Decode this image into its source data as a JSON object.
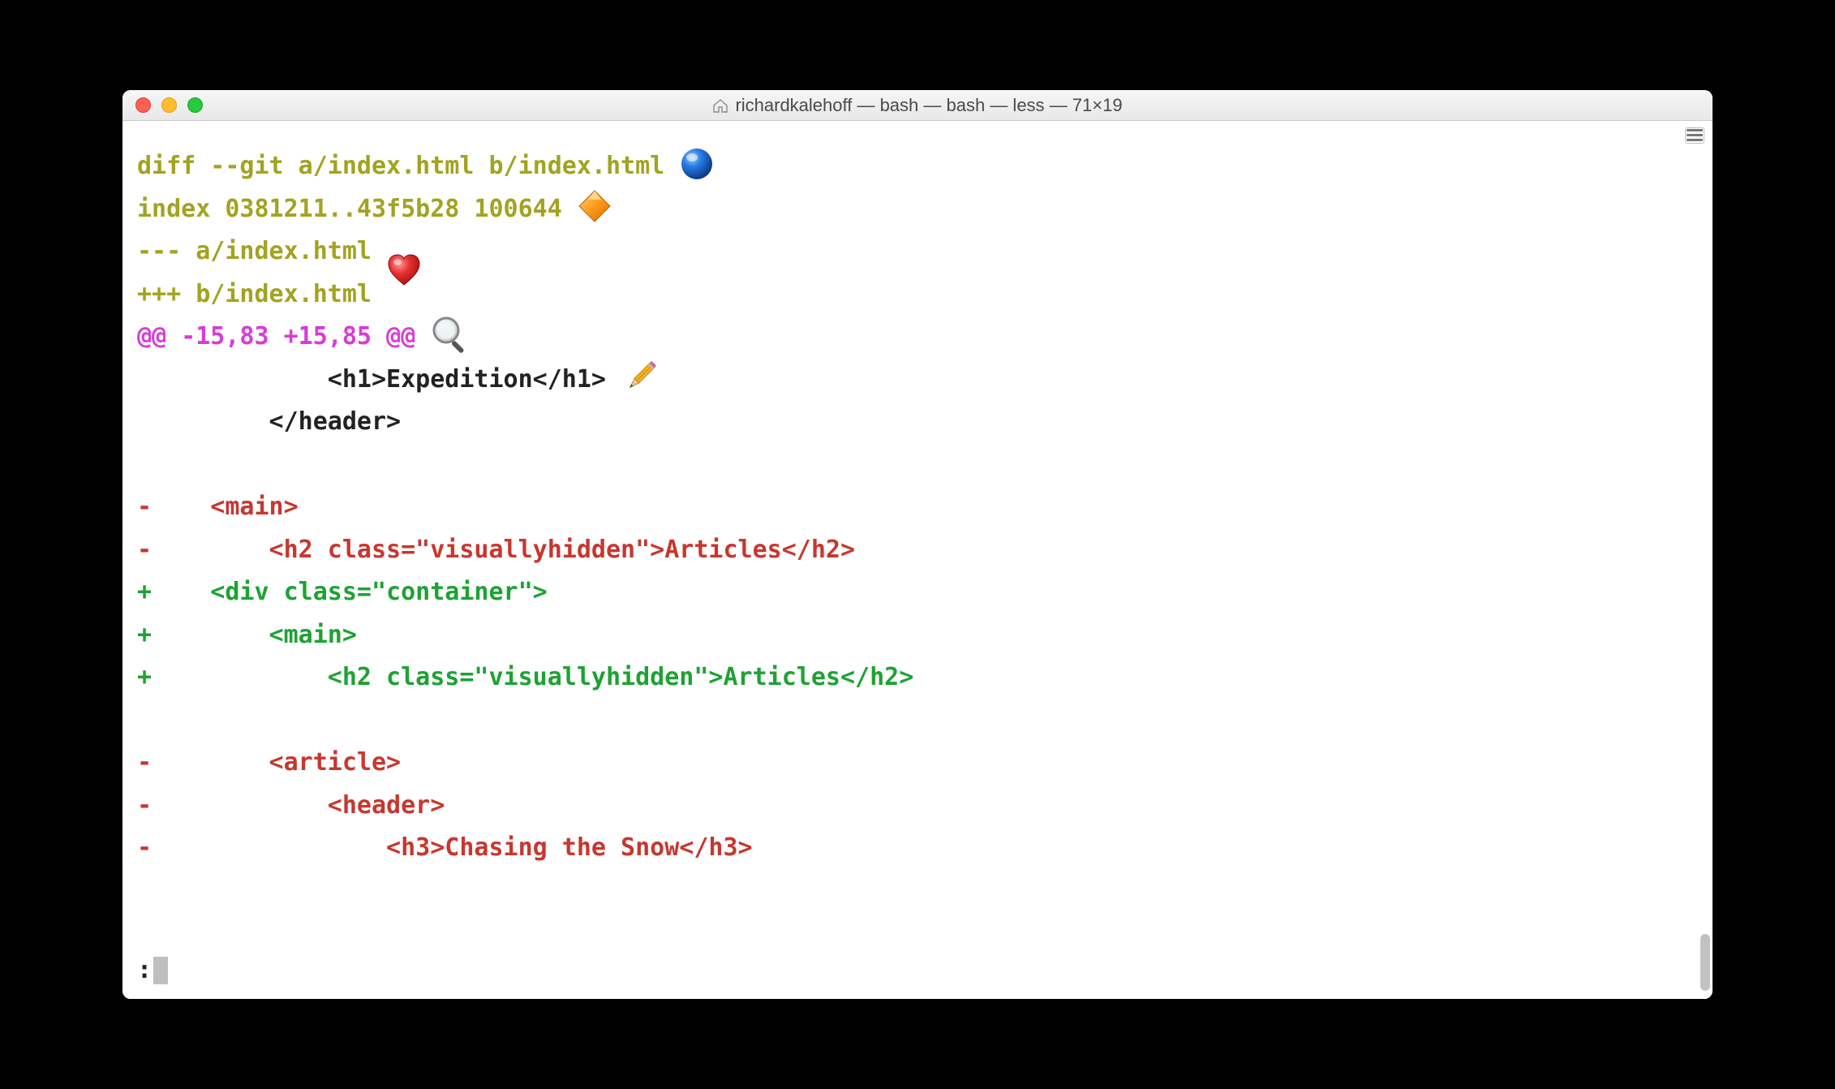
{
  "window": {
    "title": "richardkalehoff — bash — bash — less — 71×19"
  },
  "diff": {
    "lines": [
      {
        "cls": "c-olive",
        "text": "diff --git a/index.html b/index.html",
        "annot": "blue-sphere"
      },
      {
        "cls": "c-olive",
        "text": "index 0381211..43f5b28 100644",
        "annot": "orange-diamond"
      },
      {
        "cls": "c-olive",
        "text": "--- a/index.html",
        "annot": null
      },
      {
        "cls": "c-olive",
        "text": "+++ b/index.html",
        "annot": "red-heart",
        "annot_inline_prev": true
      },
      {
        "cls": "c-magenta",
        "text": "@@ -15,83 +15,85 @@",
        "annot": "magnifier"
      },
      {
        "cls": "c-default",
        "text": "             <h1>Expedition</h1>",
        "annot": "pencil"
      },
      {
        "cls": "c-default",
        "text": "         </header>",
        "annot": null
      },
      {
        "cls": "c-default",
        "text": " ",
        "annot": null
      },
      {
        "cls": "c-red",
        "text": "-    <main>",
        "annot": null
      },
      {
        "cls": "c-red",
        "text": "-        <h2 class=\"visuallyhidden\">Articles</h2>",
        "annot": null
      },
      {
        "cls": "c-green",
        "text": "+    <div class=\"container\">",
        "annot": null
      },
      {
        "cls": "c-green",
        "text": "+        <main>",
        "annot": null
      },
      {
        "cls": "c-green",
        "text": "+            <h2 class=\"visuallyhidden\">Articles</h2>",
        "annot": null
      },
      {
        "cls": "c-default",
        "text": " ",
        "annot": null
      },
      {
        "cls": "c-red",
        "text": "-        <article>",
        "annot": null
      },
      {
        "cls": "c-red",
        "text": "-            <header>",
        "annot": null
      },
      {
        "cls": "c-red",
        "text": "-                <h3>Chasing the Snow</h3>",
        "annot": null
      }
    ]
  },
  "prompt": {
    "char": ":"
  },
  "annotations": {
    "blue-sphere": "blue sphere marker",
    "orange-diamond": "orange diamond marker",
    "red-heart": "red heart marker",
    "magnifier": "magnifying glass marker",
    "pencil": "pencil marker"
  }
}
